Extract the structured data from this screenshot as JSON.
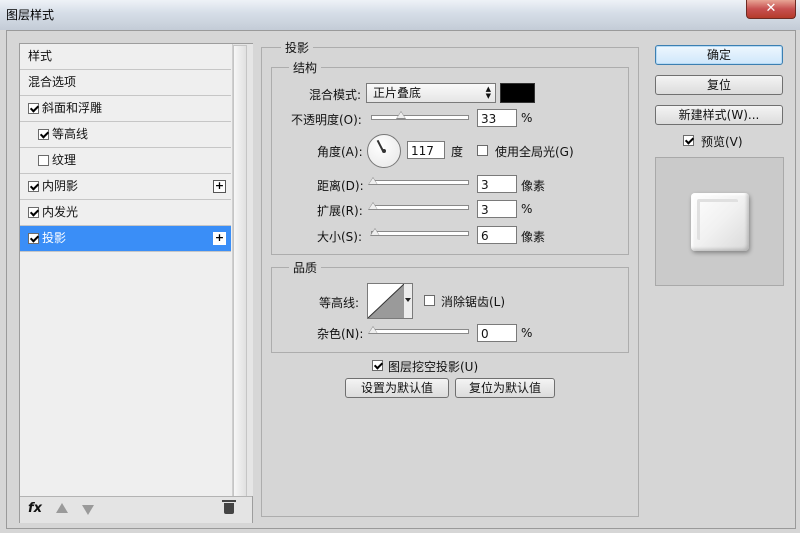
{
  "window": {
    "title": "图层样式",
    "close_symbol": "✕"
  },
  "sidebar": {
    "items": [
      {
        "label": "样式",
        "checkable": false,
        "checked": false,
        "indent": false,
        "active": false,
        "plus": false
      },
      {
        "label": "混合选项",
        "checkable": false,
        "checked": false,
        "indent": false,
        "active": false,
        "plus": false
      },
      {
        "label": "斜面和浮雕",
        "checkable": true,
        "checked": true,
        "indent": false,
        "active": false,
        "plus": false
      },
      {
        "label": "等高线",
        "checkable": true,
        "checked": true,
        "indent": true,
        "active": false,
        "plus": false
      },
      {
        "label": "纹理",
        "checkable": true,
        "checked": false,
        "indent": true,
        "active": false,
        "plus": false
      },
      {
        "label": "内阴影",
        "checkable": true,
        "checked": true,
        "indent": false,
        "active": false,
        "plus": true
      },
      {
        "label": "内发光",
        "checkable": true,
        "checked": true,
        "indent": false,
        "active": false,
        "plus": false
      },
      {
        "label": "投影",
        "checkable": true,
        "checked": true,
        "indent": false,
        "active": true,
        "plus": true
      }
    ],
    "plus_symbol": "+",
    "fx_label": "fx"
  },
  "drop_shadow": {
    "section_title": "投影",
    "structure": {
      "title": "结构",
      "blend_mode_label": "混合模式:",
      "blend_mode_value": "正片叠底",
      "shadow_color": "#000000",
      "opacity_label": "不透明度(O):",
      "opacity_value": "33",
      "opacity_unit": "%",
      "angle_label": "角度(A):",
      "angle_value": "117",
      "angle_unit": "度",
      "global_light_label": "使用全局光(G)",
      "global_light_checked": false,
      "distance_label": "距离(D):",
      "distance_value": "3",
      "distance_unit": "像素",
      "spread_label": "扩展(R):",
      "spread_value": "3",
      "spread_unit": "%",
      "size_label": "大小(S):",
      "size_value": "6",
      "size_unit": "像素"
    },
    "quality": {
      "title": "品质",
      "contour_label": "等高线:",
      "antialias_label": "消除锯齿(L)",
      "antialias_checked": false,
      "noise_label": "杂色(N):",
      "noise_value": "0",
      "noise_unit": "%"
    },
    "knockout_label": "图层挖空投影(U)",
    "knockout_checked": true,
    "make_default_label": "设置为默认值",
    "reset_default_label": "复位为默认值"
  },
  "actions": {
    "ok_label": "确定",
    "reset_label": "复位",
    "new_style_label": "新建样式(W)...",
    "preview_label": "预览(V)",
    "preview_checked": true
  }
}
